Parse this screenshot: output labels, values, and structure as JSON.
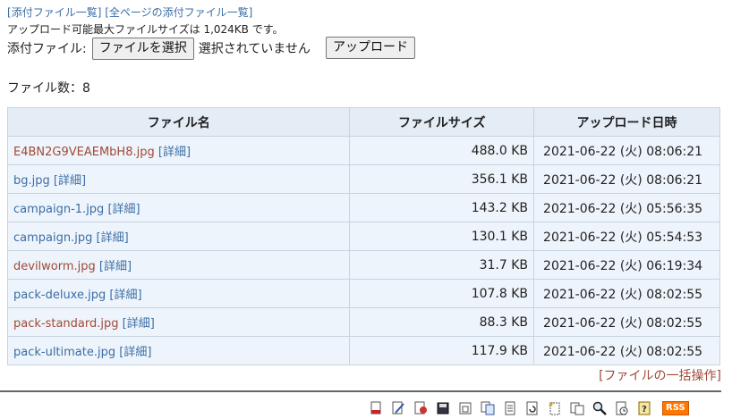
{
  "top_links": {
    "open": "[",
    "attachment_list": "添付ファイル一覧",
    "sep": "] [",
    "all_pages_list": "全ページの添付ファイル一覧",
    "close": "]"
  },
  "max_size_text": "アップロード可能最大ファイルサイズは 1,024KB です。",
  "upload": {
    "label": "添付ファイル:",
    "choose_button": "ファイルを選択",
    "no_file_text": "選択されていません",
    "upload_button": "アップロード"
  },
  "file_count": "ファイル数：8",
  "table": {
    "headers": [
      "ファイル名",
      "ファイルサイズ",
      "アップロード日時"
    ],
    "detail_label": "[詳細]",
    "rows": [
      {
        "name": "E4BN2G9VEAEMbH8.jpg",
        "size": "488.0 KB",
        "date": "2021-06-22 (火) 08:06:21"
      },
      {
        "name": "bg.jpg",
        "size": "356.1 KB",
        "date": "2021-06-22 (火) 08:06:21"
      },
      {
        "name": "campaign-1.jpg",
        "size": "143.2 KB",
        "date": "2021-06-22 (火) 05:56:35"
      },
      {
        "name": "campaign.jpg",
        "size": "130.1 KB",
        "date": "2021-06-22 (火) 05:54:53"
      },
      {
        "name": "devilworm.jpg",
        "size": "31.7 KB",
        "date": "2021-06-22 (火) 06:19:34"
      },
      {
        "name": "pack-deluxe.jpg",
        "size": "107.8 KB",
        "date": "2021-06-22 (火) 08:02:55"
      },
      {
        "name": "pack-standard.jpg",
        "size": "88.3 KB",
        "date": "2021-06-22 (火) 08:02:55"
      },
      {
        "name": "pack-ultimate.jpg",
        "size": "117.9 KB",
        "date": "2021-06-22 (火) 08:02:55"
      }
    ]
  },
  "bulk": {
    "open": "[",
    "label": "ファイルの一括操作",
    "close": "]"
  },
  "toolbar": {
    "icons": [
      "top-icon",
      "edit-icon",
      "diff-icon",
      "backup-icon",
      "attach-icon",
      "copy-icon",
      "rename-icon",
      "reload-icon",
      "new-icon",
      "list-icon",
      "search-icon",
      "recent-icon",
      "help-icon"
    ],
    "rss_label": "RSS"
  },
  "colors": {
    "link": "#3a6ea5",
    "visited": "#a04a38",
    "header_bg": "#e4ecf5",
    "cell_bg": "#eef4fb",
    "rss": "#ff7700"
  }
}
